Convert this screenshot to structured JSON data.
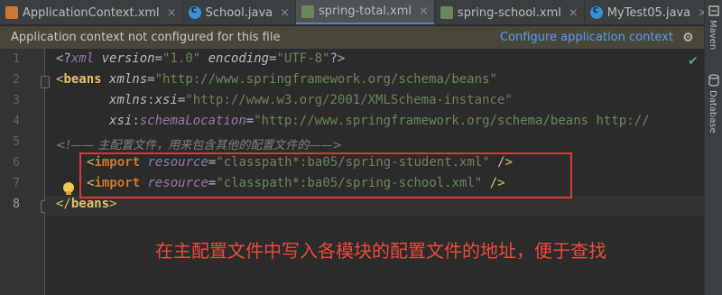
{
  "tabs": [
    {
      "label": "ApplicationContext.xml",
      "icon": "xml-file-icon",
      "active": false
    },
    {
      "label": "School.java",
      "icon": "java-class-icon",
      "active": false
    },
    {
      "label": "spring-total.xml",
      "icon": "xml-file-icon",
      "active": true
    },
    {
      "label": "spring-school.xml",
      "icon": "xml-file-icon",
      "active": false
    },
    {
      "label": "MyTest05.java",
      "icon": "java-class-icon",
      "active": false
    },
    {
      "label": "m",
      "icon": "java-class-icon",
      "active": false
    }
  ],
  "close_glyph": "×",
  "notification": {
    "message": "Application context not configured for this file",
    "link": "Configure application context"
  },
  "right_strip": {
    "maven": "Maven",
    "database": "Database"
  },
  "line_numbers": [
    "1",
    "2",
    "3",
    "4",
    "5",
    "6",
    "7",
    "8"
  ],
  "code": {
    "l1": {
      "open": "<?",
      "tag": "xml",
      "a1": " version",
      "eq1": "=",
      "v1": "\"1.0\"",
      "a2": " encoding",
      "eq2": "=",
      "v2": "\"UTF-8\"",
      "close": "?>"
    },
    "l2": {
      "open": "<",
      "tag": "beans",
      "attr": " xmlns",
      "eq": "=",
      "val": "\"http://www.springframework.org/schema/beans\""
    },
    "l3": {
      "indent": "       ",
      "ns": "xmlns",
      "colon": ":",
      "attr": "xsi",
      "eq": "=",
      "val": "\"http://www.w3.org/2001/XMLSchema-instance\""
    },
    "l4": {
      "indent": "       ",
      "ns": "xsi",
      "colon": ":",
      "attr": "schemaLocation",
      "eq": "=",
      "val": "\"http://www.springframework.org/schema/beans http://"
    },
    "l5": {
      "text": "<!—— 主配置文件，用来包含其他的配置文件的——>"
    },
    "l6": {
      "indent": "  ",
      "open": "<",
      "tag": "import",
      "attr": " resource",
      "eq": "=",
      "val": "\"classpath*:ba05/spring-student.xml\"",
      "close": " />"
    },
    "l7": {
      "indent": "  ",
      "open": "<",
      "tag": "import",
      "attr": " resource",
      "eq": "=",
      "val": "\"classpath*:ba05/spring-school.xml\"",
      "close": " />"
    },
    "l8": {
      "open": "</",
      "tag": "beans",
      "close": ">"
    }
  },
  "annotation": "在主配置文件中写入各模块的配置文件的地址，便于查找"
}
